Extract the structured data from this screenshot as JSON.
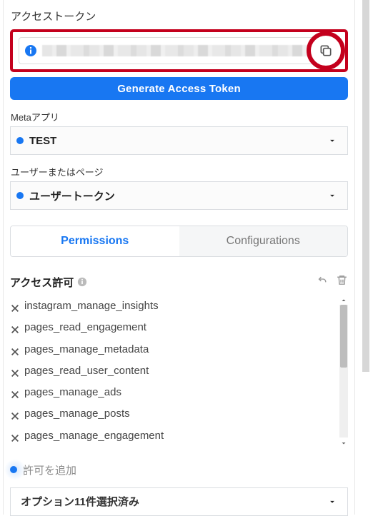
{
  "section": {
    "access_token_title": "アクセストークン",
    "generate_button": "Generate Access Token"
  },
  "meta_app": {
    "label": "Metaアプリ",
    "selected": "TEST"
  },
  "user_page": {
    "label": "ユーザーまたはページ",
    "selected": "ユーザートークン"
  },
  "tabs": {
    "permissions": "Permissions",
    "configurations": "Configurations"
  },
  "permissions": {
    "title": "アクセス許可",
    "add_label": "許可を追加",
    "options_selected": "オプション11件選択済み",
    "items": [
      "instagram_manage_insights",
      "pages_read_engagement",
      "pages_manage_metadata",
      "pages_read_user_content",
      "pages_manage_ads",
      "pages_manage_posts",
      "pages_manage_engagement"
    ]
  }
}
